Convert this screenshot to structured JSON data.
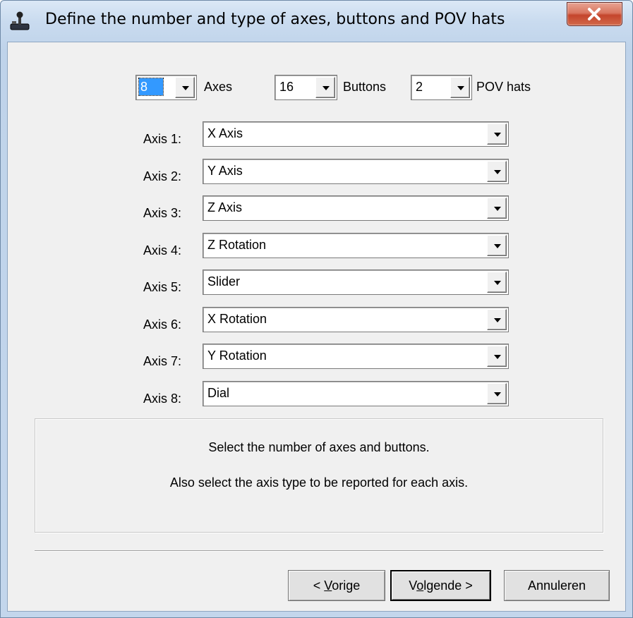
{
  "window": {
    "title": "Define the number and type of axes, buttons and POV hats"
  },
  "counts": {
    "axes_value": "8",
    "axes_label": "Axes",
    "buttons_value": "16",
    "buttons_label": "Buttons",
    "pov_value": "2",
    "pov_label": "POV hats"
  },
  "axes": [
    {
      "label": "Axis 1:",
      "value": "X Axis"
    },
    {
      "label": "Axis 2:",
      "value": "Y Axis"
    },
    {
      "label": "Axis 3:",
      "value": "Z Axis"
    },
    {
      "label": "Axis 4:",
      "value": "Z Rotation"
    },
    {
      "label": "Axis 5:",
      "value": "Slider"
    },
    {
      "label": "Axis 6:",
      "value": "X Rotation"
    },
    {
      "label": "Axis 7:",
      "value": "Y Rotation"
    },
    {
      "label": "Axis 8:",
      "value": "Dial"
    }
  ],
  "info": {
    "line1": "Select the number of axes and buttons.",
    "line2": "Also select the axis type to be reported for each axis."
  },
  "buttons": {
    "back_prefix": "< ",
    "back_mnemonic": "V",
    "back_rest": "orige",
    "next_prefix": "V",
    "next_mnemonic": "o",
    "next_rest": "lgende >",
    "cancel": "Annuleren"
  },
  "icons": {
    "app": "joystick-icon",
    "close": "close-icon",
    "dropdown": "chevron-down-icon"
  },
  "colors": {
    "close_button": "#c4452c",
    "selection": "#3399ff",
    "dialog_bg": "#f0f0f0"
  }
}
